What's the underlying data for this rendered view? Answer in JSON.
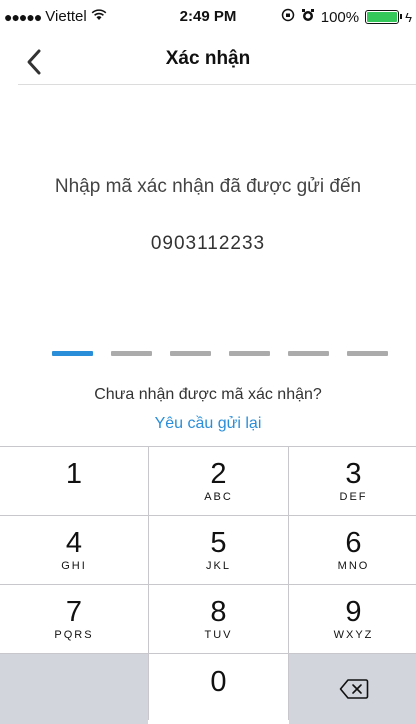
{
  "status_bar": {
    "signal": "●●●●●",
    "carrier": "Viettel",
    "wifi": "⌅",
    "time": "2:49 PM",
    "icons": "⦿ ⏰",
    "battery_percent": "100%",
    "battery_level": 1.0,
    "charging": "ϟ"
  },
  "nav": {
    "title": "Xác nhận",
    "back_icon": "chevron-left-icon"
  },
  "content": {
    "prompt": "Nhập mã xác nhận đã được gửi đến",
    "phone": "0903112233",
    "code_length": 6,
    "active_slot": 0,
    "not_received": "Chưa nhận được mã xác nhận?",
    "resend": "Yêu cầu gửi lại"
  },
  "keypad": {
    "keys": [
      {
        "digit": "1",
        "letters": ""
      },
      {
        "digit": "2",
        "letters": "ABC"
      },
      {
        "digit": "3",
        "letters": "DEF"
      },
      {
        "digit": "4",
        "letters": "GHI"
      },
      {
        "digit": "5",
        "letters": "JKL"
      },
      {
        "digit": "6",
        "letters": "MNO"
      },
      {
        "digit": "7",
        "letters": "PQRS"
      },
      {
        "digit": "8",
        "letters": "TUV"
      },
      {
        "digit": "9",
        "letters": "WXYZ"
      },
      {
        "digit": "0",
        "letters": ""
      }
    ],
    "delete_icon": "backspace-icon"
  },
  "colors": {
    "accent": "#2a8ed8",
    "slot_inactive": "#ababab",
    "battery": "#34c759"
  }
}
